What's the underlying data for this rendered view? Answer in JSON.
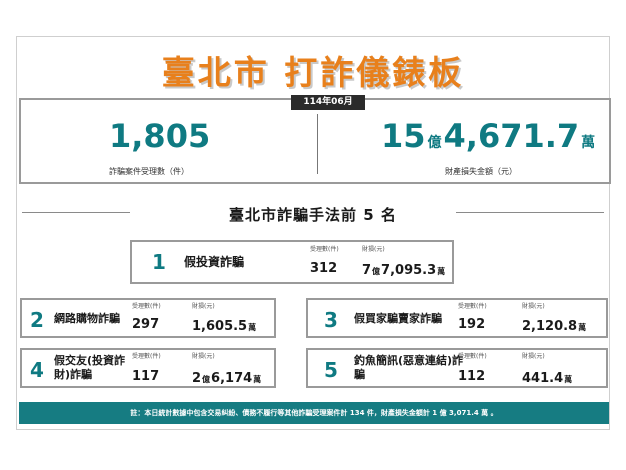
{
  "header": {
    "title": "臺北市  打詐儀錶板"
  },
  "summary": {
    "month": "114年06月",
    "cases_value": "1,805",
    "cases_label": "詐騙案件受理數（件）",
    "loss_yi": "15",
    "loss_yi_unit": "億",
    "loss_wan": "4,671.7",
    "loss_wan_unit": "萬",
    "loss_label": "財產損失金額（元）"
  },
  "section": {
    "title": "臺北市詐騙手法前 5 名"
  },
  "labels": {
    "count": "受理數(件)",
    "loss": "財損(元)"
  },
  "ranks": [
    {
      "rank": "1",
      "name": "假投資詐騙",
      "count": "312",
      "yi": "7",
      "yi_unit": "億",
      "amount": "7,095.3",
      "unit": "萬"
    },
    {
      "rank": "2",
      "name": "網路購物詐騙",
      "count": "297",
      "amount": "1,605.5",
      "unit": "萬"
    },
    {
      "rank": "3",
      "name": "假買家騙賣家詐騙",
      "count": "192",
      "amount": "2,120.8",
      "unit": "萬"
    },
    {
      "rank": "4",
      "name_line1": "假交友(投資詐",
      "name_line2": "財)詐騙",
      "count": "117",
      "yi": "2",
      "yi_unit": "億",
      "amount": "6,174",
      "unit": "萬"
    },
    {
      "rank": "5",
      "name_line1": "釣魚簡訊(惡意連結)詐",
      "name_line2": "騙",
      "count": "112",
      "amount": "441.4",
      "unit": "萬"
    }
  ],
  "footer": {
    "note": "註：本日統計數據中包含交易糾紛、債務不履行等其他詐騙受理案件計 134 件，財產損失金額計 1 億 3,071.4 萬 。"
  },
  "colors": {
    "accent_orange": "#e8801c",
    "teal": "#0f7a82",
    "note_bg": "#167c82"
  }
}
